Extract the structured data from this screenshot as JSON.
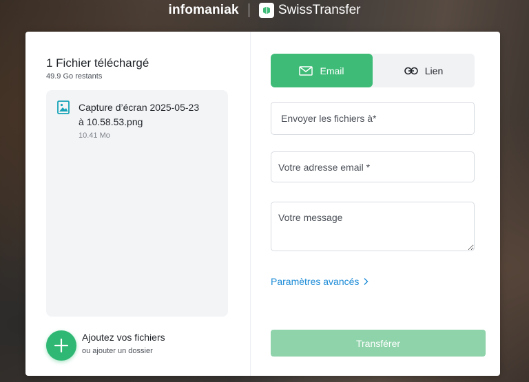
{
  "header": {
    "brand_infomaniak": "infomaniak",
    "brand_swisstransfer": "SwissTransfer"
  },
  "files": {
    "title": "1 Fichier téléchargé",
    "remaining": "49.9 Go restants",
    "items": [
      {
        "name": "Capture d’écran 2025-05-23 à 10.58.53.png",
        "size": "10.41 Mo",
        "icon": "image-file-icon"
      }
    ]
  },
  "add": {
    "title": "Ajoutez vos fichiers",
    "subtitle": "ou ajouter un dossier",
    "icon": "plus-icon"
  },
  "tabs": [
    {
      "label": "Email",
      "icon": "mail-icon",
      "active": true
    },
    {
      "label": "Lien",
      "icon": "link-icon",
      "active": false
    }
  ],
  "form": {
    "recipients_placeholder": "Envoyer les fichiers à*",
    "email_placeholder": "Votre adresse email *",
    "message_placeholder": "Votre message",
    "advanced_label": "Paramètres avancés",
    "submit_label": "Transférer",
    "submit_enabled": false
  },
  "colors": {
    "accent": "#3ebc77",
    "accent_disabled": "#8ed3aa",
    "link": "#1a8ad6"
  }
}
